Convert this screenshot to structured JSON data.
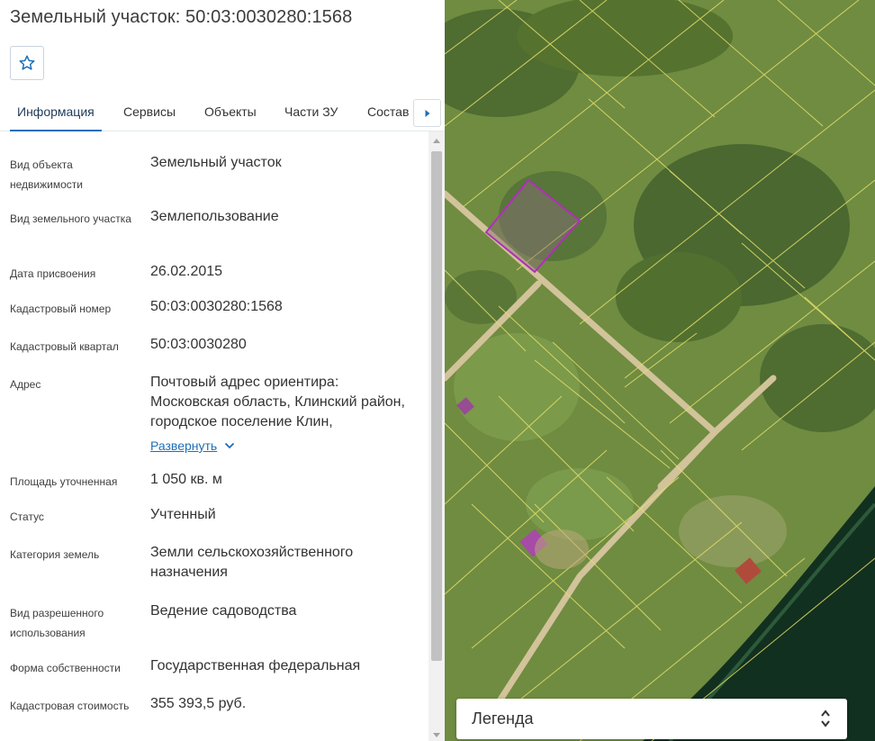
{
  "header": {
    "title": "Земельный участок: 50:03:0030280:1568"
  },
  "tabs": [
    {
      "label": "Информация",
      "active": true
    },
    {
      "label": "Сервисы",
      "active": false
    },
    {
      "label": "Объекты",
      "active": false
    },
    {
      "label": "Части ЗУ",
      "active": false
    },
    {
      "label": "Состав",
      "active": false
    }
  ],
  "info": {
    "rows": [
      {
        "label": "Вид объекта недвижимости",
        "value": "Земельный участок"
      },
      {
        "label": "Вид земельного участка",
        "value": "Землепользование"
      },
      {
        "label": "Дата присвоения",
        "value": "26.02.2015"
      },
      {
        "label": "Кадастровый номер",
        "value": "50:03:0030280:1568"
      },
      {
        "label": "Кадастровый квартал",
        "value": "50:03:0030280"
      },
      {
        "label": "Адрес",
        "value": "Почтовый адрес ориентира: Московская область, Клинский район, городское поселение Клин,",
        "expand_label": "Развернуть"
      },
      {
        "label": "Площадь уточненная",
        "value": "1 050 кв. м"
      },
      {
        "label": "Статус",
        "value": "Учтенный"
      },
      {
        "label": "Категория земель",
        "value": "Земли сельскохозяйственного назначения"
      },
      {
        "label": "Вид разрешенного использования",
        "value": "Ведение садоводства"
      },
      {
        "label": "Форма собственности",
        "value": "Государственная федеральная"
      },
      {
        "label": "Кадастровая стоимость",
        "value": "355 393,5 руб."
      }
    ]
  },
  "map": {
    "legend_label": "Легенда"
  },
  "colors": {
    "accent": "#1e6fb8",
    "parcel_highlight": "#9b2fa8",
    "parcel_lines": "#e6df6a"
  },
  "icons": {
    "favorite": "star-outline-icon",
    "tabs_next": "caret-right-icon",
    "expand": "chevron-down-icon",
    "legend_toggle": "chevron-up-down-icon"
  }
}
